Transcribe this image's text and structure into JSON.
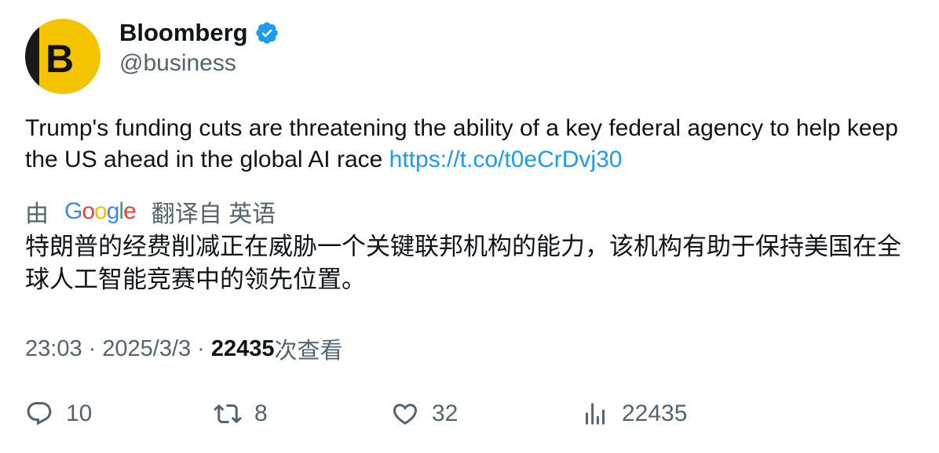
{
  "account": {
    "avatar_letter": "B",
    "name": "Bloomberg",
    "handle": "@business",
    "verified_icon": "verified-badge-icon",
    "verified_color": "#1d9bf0",
    "avatar_color": "#f5c400"
  },
  "tweet": {
    "text": "Trump's funding cuts are threatening the ability of a key federal agency to help keep the US ahead in the global AI race ",
    "link": "https://t.co/t0eCrDvj30",
    "link_color": "#1d9bf0"
  },
  "translation": {
    "prefix": "由",
    "google": [
      "G",
      "o",
      "o",
      "g",
      "l",
      "e"
    ],
    "suffix": "翻译自 英语",
    "text": "特朗普的经费削减正在威胁一个关键联邦机构的能力，该机构有助于保持美国在全球人工智能竞赛中的领先位置。"
  },
  "meta": {
    "time": "23:03",
    "sep1": "·",
    "date": "2025/3/3",
    "sep2": "·",
    "views_count": "22435",
    "views_label": "次查看"
  },
  "actions": {
    "reply": {
      "icon": "reply-icon",
      "count": "10"
    },
    "retweet": {
      "icon": "retweet-icon",
      "count": "8"
    },
    "like": {
      "icon": "heart-icon",
      "count": "32"
    },
    "views": {
      "icon": "views-chart-icon",
      "count": "22435"
    }
  }
}
